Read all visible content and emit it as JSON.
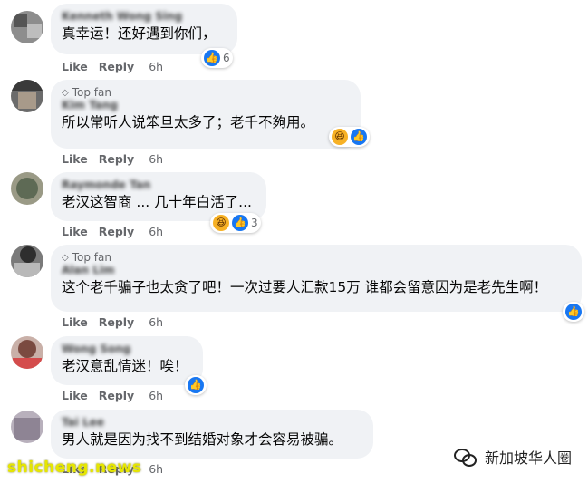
{
  "colors": {
    "bubble": "#f0f2f5",
    "like": "#1877f2",
    "haha": "#f7b125",
    "meta": "#65676b"
  },
  "labels": {
    "like": "Like",
    "reply": "Reply",
    "top_fan": "Top fan"
  },
  "comments": [
    {
      "name": "Kenneth Wong Sing",
      "text": "真幸运！还好遇到你们，",
      "time": "6h",
      "reaction_count": "6",
      "reactions": [
        "like-icon"
      ]
    },
    {
      "name": "Kim Tang",
      "text": "所以常听人说笨旦太多了；老千不夠用。",
      "time": "6h",
      "top_fan": true,
      "reaction_count": "",
      "reactions": [
        "haha-icon",
        "like-icon"
      ]
    },
    {
      "name": "Raymonde Tan",
      "text": "老汉这智商 ... 几十年白活了...",
      "time": "6h",
      "reaction_count": "3",
      "reactions": [
        "haha-icon",
        "like-icon"
      ]
    },
    {
      "name": "Alan Lim",
      "text": "这个老千骗子也太贪了吧！一次过要人汇款15万 谁都会留意因为是老先生啊！",
      "time": "6h",
      "top_fan": true,
      "reaction_count": "",
      "reactions": [
        "like-icon"
      ]
    },
    {
      "name": "Wong Song",
      "text": "老汉意乱情迷！唉！",
      "time": "6h",
      "reaction_count": "",
      "reactions": [
        "like-icon"
      ]
    },
    {
      "name": "Tai Lee",
      "text": "男人就是因为找不到结婚对象才会容易被骗。",
      "time": "6h",
      "reaction_count": "",
      "reactions": []
    }
  ],
  "watermark": "shicheng.news",
  "wechat_account": "新加坡华人圈"
}
